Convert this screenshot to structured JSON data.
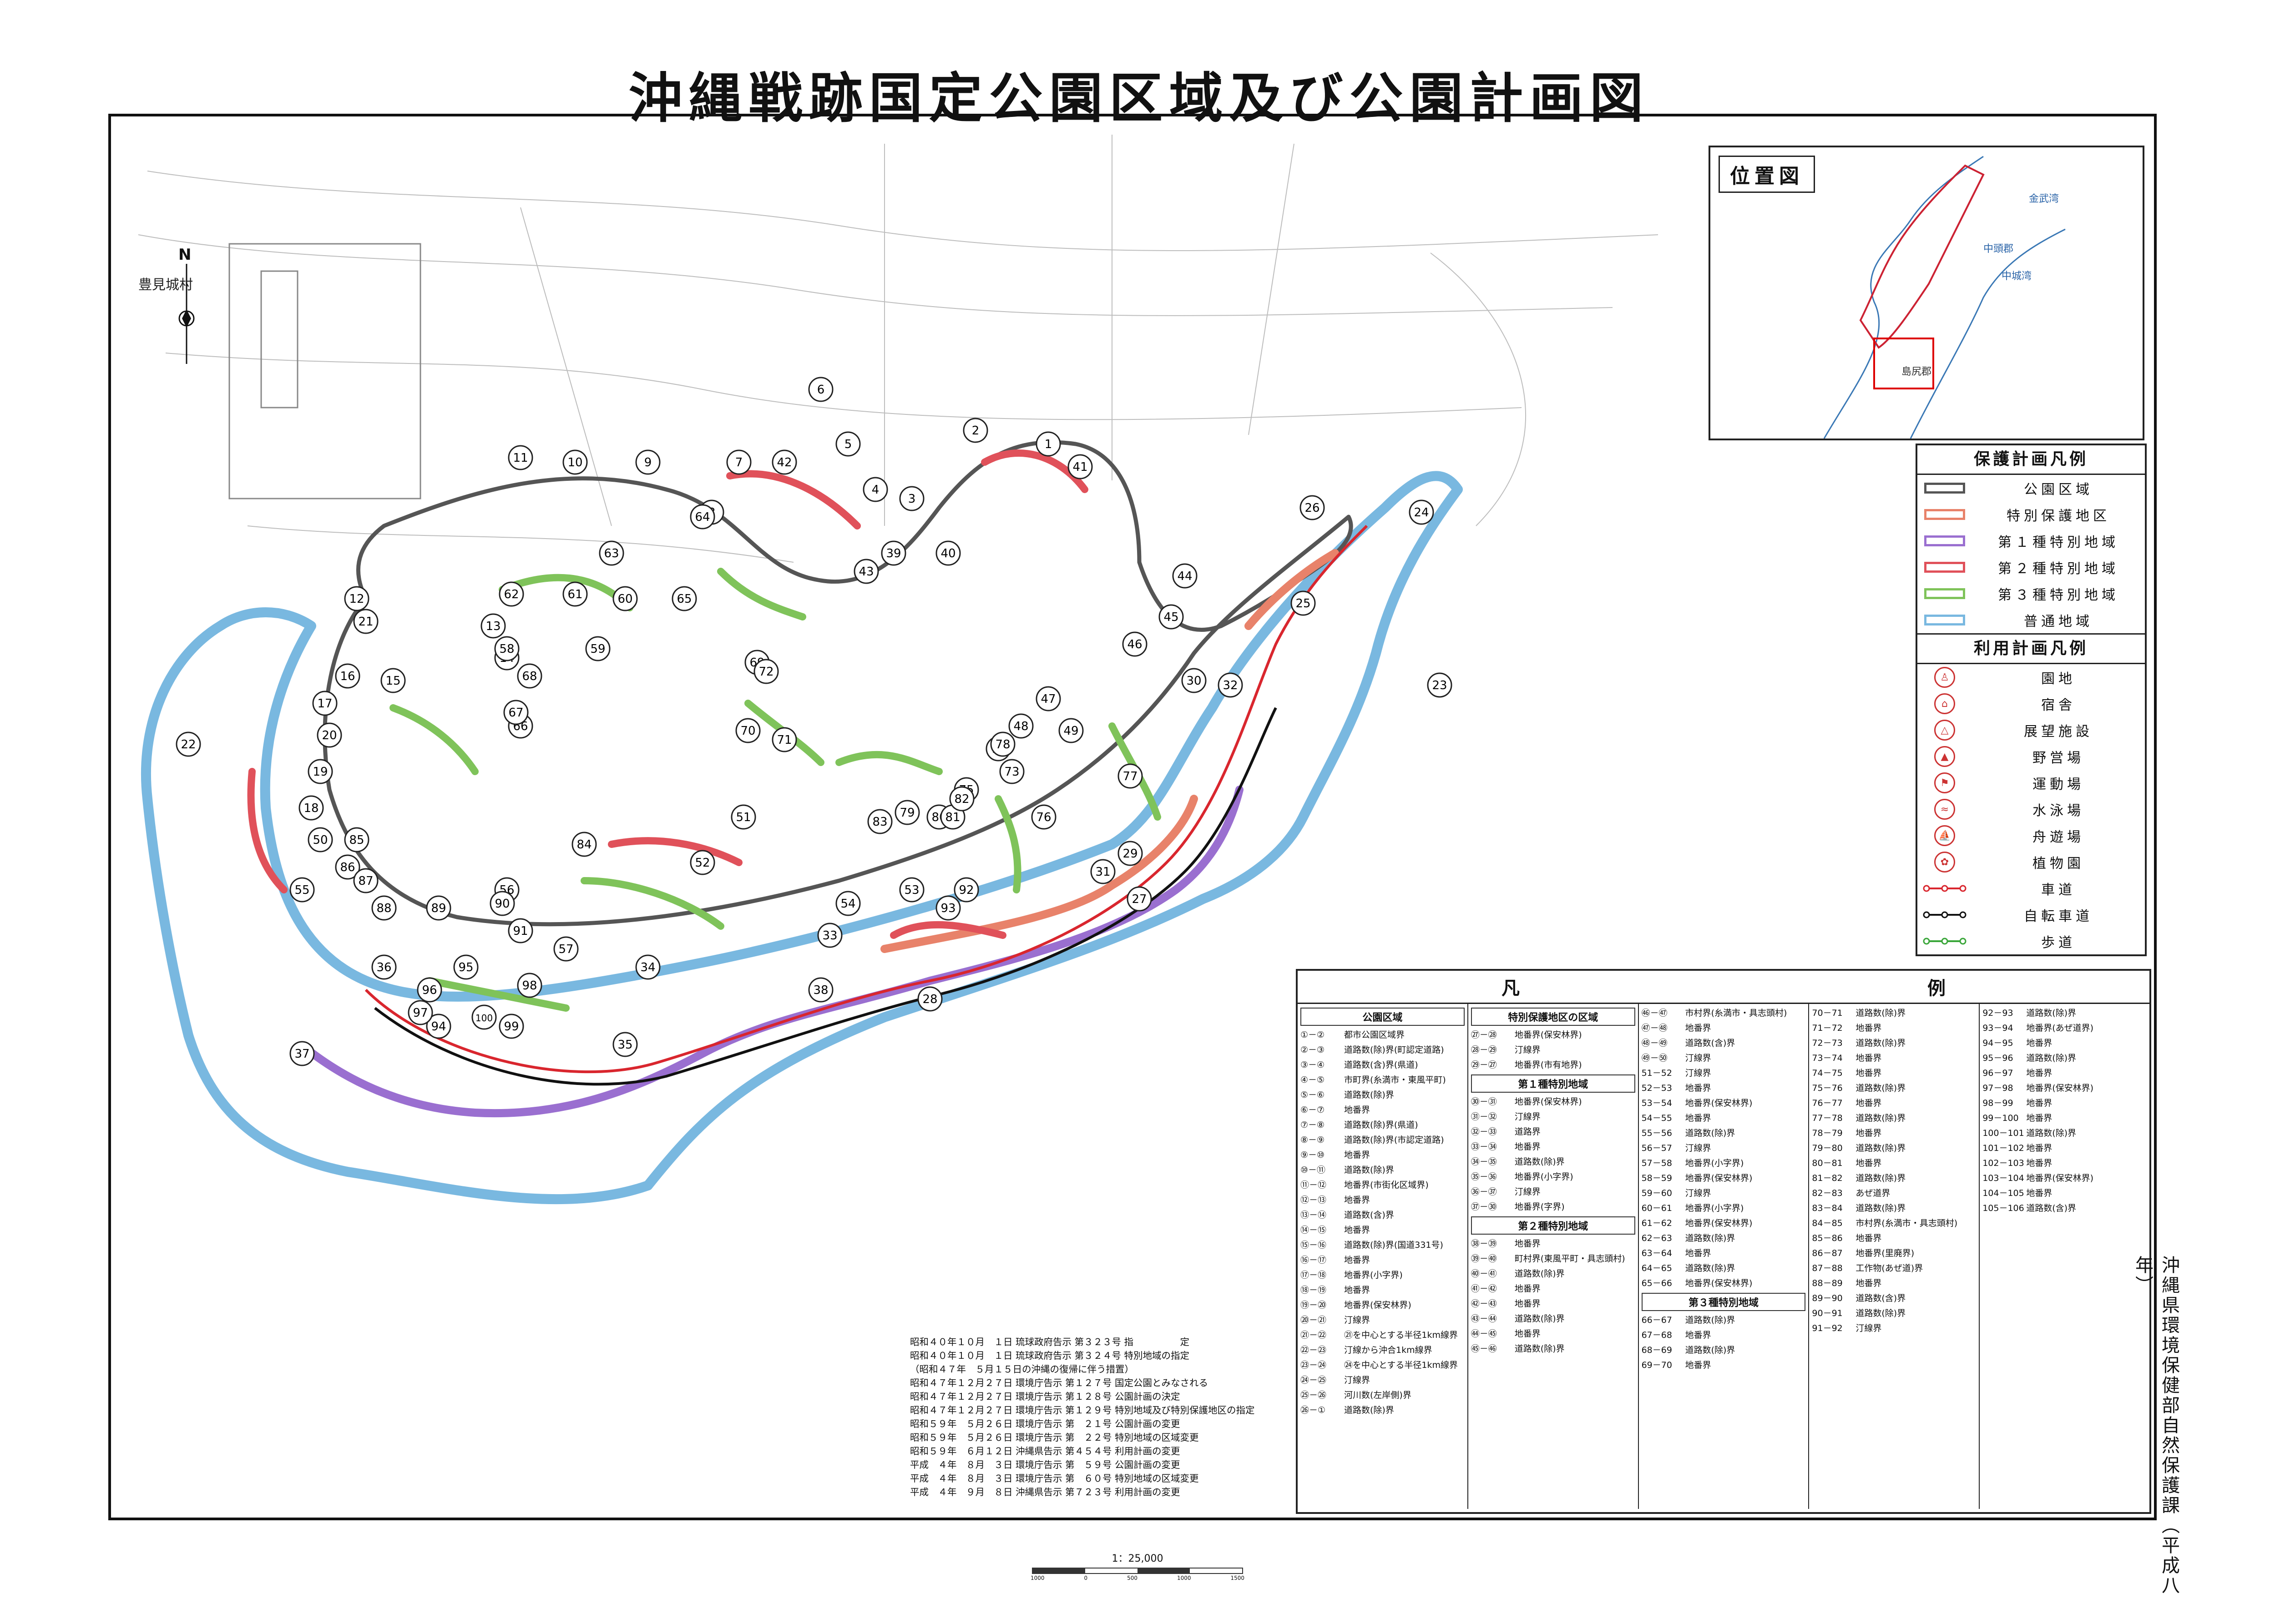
{
  "title": "沖縄戦跡国定公園区域及び公園計画図",
  "north_label": "N",
  "agency_vertical": "沖縄県環境保健部自然保護課（平成八年）",
  "colors": {
    "park_boundary": "#555555",
    "special_protection": "#e8826a",
    "class1_special": "#9a6fd0",
    "class2_special": "#e0515a",
    "class3_special": "#7fc35a",
    "ordinary": "#79b8e0",
    "road": "#d9262e",
    "cycle_road": "#111111",
    "footpath": "#3aa63a"
  },
  "inset": {
    "title": "位置図",
    "place_labels": [
      "中頭郡",
      "島尻郡",
      "中城湾",
      "金武湾"
    ]
  },
  "map_labels": {
    "village": "豊見城村",
    "markers": [
      "1",
      "2",
      "3",
      "4",
      "5",
      "6",
      "7",
      "8",
      "9",
      "10",
      "11",
      "12",
      "13",
      "14",
      "15",
      "16",
      "17",
      "18",
      "19",
      "20",
      "21",
      "22",
      "23",
      "24",
      "25",
      "26",
      "27",
      "28",
      "29",
      "30",
      "31",
      "32",
      "33",
      "34",
      "35",
      "36",
      "37",
      "38",
      "39",
      "40",
      "41",
      "42",
      "43",
      "44",
      "45",
      "46",
      "47",
      "48",
      "49",
      "50",
      "51",
      "52",
      "53",
      "54",
      "55",
      "56",
      "57",
      "58",
      "59",
      "60",
      "61",
      "62",
      "63",
      "64",
      "65",
      "66",
      "67",
      "68",
      "69",
      "70",
      "71",
      "72",
      "73",
      "74",
      "75",
      "76",
      "77",
      "78",
      "79",
      "80",
      "81",
      "82",
      "83",
      "84",
      "85",
      "86",
      "87",
      "88",
      "89",
      "90",
      "91",
      "92",
      "93",
      "94",
      "95",
      "96",
      "97",
      "98",
      "99",
      "100"
    ]
  },
  "protection_legend": {
    "title": "保護計画凡例",
    "items": [
      {
        "label": "公園区域",
        "color_key": "park_boundary"
      },
      {
        "label": "特別保護地区",
        "color_key": "special_protection"
      },
      {
        "label": "第１種特別地域",
        "color_key": "class1_special"
      },
      {
        "label": "第２種特別地域",
        "color_key": "class2_special"
      },
      {
        "label": "第３種特別地域",
        "color_key": "class3_special"
      },
      {
        "label": "普通地域",
        "color_key": "ordinary"
      }
    ]
  },
  "use_legend": {
    "title": "利用計画凡例",
    "facilities": [
      {
        "label": "園地",
        "glyph": "♙"
      },
      {
        "label": "宿舎",
        "glyph": "⌂"
      },
      {
        "label": "展望施設",
        "glyph": "△"
      },
      {
        "label": "野営場",
        "glyph": "▲"
      },
      {
        "label": "運動場",
        "glyph": "⚑"
      },
      {
        "label": "水泳場",
        "glyph": "≈"
      },
      {
        "label": "舟遊場",
        "glyph": "⛵"
      },
      {
        "label": "植物園",
        "glyph": "✿"
      }
    ],
    "routes": [
      {
        "label": "車道",
        "color_key": "road"
      },
      {
        "label": "自転車道",
        "color_key": "cycle_road"
      },
      {
        "label": "歩道",
        "color_key": "footpath"
      }
    ]
  },
  "boundary_table": {
    "title_left": "凡",
    "title_right": "例",
    "columns": [
      [
        {
          "section": "公園区域"
        },
        {
          "code": "①－②",
          "label": "都市公園区域界"
        },
        {
          "code": "②－③",
          "label": "道路数(除)界(町認定道路)"
        },
        {
          "code": "③－④",
          "label": "道路数(含)界(県道)"
        },
        {
          "code": "④－⑤",
          "label": "市町界(糸満市・東風平町)"
        },
        {
          "code": "⑤－⑥",
          "label": "道路数(除)界"
        },
        {
          "code": "⑥－⑦",
          "label": "地番界"
        },
        {
          "code": "⑦－⑧",
          "label": "道路数(除)界(県道)"
        },
        {
          "code": "⑧－⑨",
          "label": "道路数(除)界(市認定道路)"
        },
        {
          "code": "⑨－⑩",
          "label": "地番界"
        },
        {
          "code": "⑩－⑪",
          "label": "道路数(除)界"
        },
        {
          "code": "⑪－⑫",
          "label": "地番界(市街化区域界)"
        },
        {
          "code": "⑫－⑬",
          "label": "地番界"
        },
        {
          "code": "⑬－⑭",
          "label": "道路数(含)界"
        },
        {
          "code": "⑭－⑮",
          "label": "地番界"
        },
        {
          "code": "⑮－⑯",
          "label": "道路数(除)界(国道331号)"
        },
        {
          "code": "⑯－⑰",
          "label": "地番界"
        },
        {
          "code": "⑰－⑱",
          "label": "地番界(小字界)"
        },
        {
          "code": "⑱－⑲",
          "label": "地番界"
        },
        {
          "code": "⑲－⑳",
          "label": "地番界(保安林界)"
        },
        {
          "code": "⑳－㉑",
          "label": "汀線界"
        },
        {
          "code": "㉑－㉒",
          "label": "㉑を中心とする半径1km線界"
        },
        {
          "code": "㉒－㉓",
          "label": "汀線から沖合1km線界"
        },
        {
          "code": "㉓－㉔",
          "label": "㉔を中心とする半径1km線界"
        },
        {
          "code": "㉔－㉕",
          "label": "汀線界"
        },
        {
          "code": "㉕－㉖",
          "label": "河川数(左岸側)界"
        },
        {
          "code": "㉖－①",
          "label": "道路数(除)界"
        }
      ],
      [
        {
          "section": "特別保護地区の区域"
        },
        {
          "code": "㉗－㉘",
          "label": "地番界(保安林界)"
        },
        {
          "code": "㉘－㉙",
          "label": "汀線界"
        },
        {
          "code": "㉙－㉗",
          "label": "地番界(市有地界)"
        },
        {
          "section": "第１種特別地域"
        },
        {
          "code": "㉚－㉛",
          "label": "地番界(保安林界)"
        },
        {
          "code": "㉛－㉜",
          "label": "汀線界"
        },
        {
          "code": "㉜－㉝",
          "label": "道路界"
        },
        {
          "code": "㉝－㉞",
          "label": "地番界"
        },
        {
          "code": "㉞－㉟",
          "label": "道路数(除)界"
        },
        {
          "code": "㉟－㊱",
          "label": "地番界(小字界)"
        },
        {
          "code": "㊱－㊲",
          "label": "汀線界"
        },
        {
          "code": "㊲－㉚",
          "label": "地番界(字界)"
        },
        {
          "section": "第２種特別地域"
        },
        {
          "code": "㊳－㊴",
          "label": "地番界"
        },
        {
          "code": "㊴－㊵",
          "label": "町村界(東風平町・具志頭村)"
        },
        {
          "code": "㊵－㊶",
          "label": "道路数(除)界"
        },
        {
          "code": "㊶－㊷",
          "label": "地番界"
        },
        {
          "code": "㊷－㊸",
          "label": "地番界"
        },
        {
          "code": "㊸－㊹",
          "label": "道路数(除)界"
        },
        {
          "code": "㊹－㊺",
          "label": "地番界"
        },
        {
          "code": "㊺－㊻",
          "label": "道路数(除)界"
        }
      ],
      [
        {
          "code": "㊻－㊼",
          "label": "市村界(糸満市・具志頭村)"
        },
        {
          "code": "㊼－㊽",
          "label": "地番界"
        },
        {
          "code": "㊽－㊾",
          "label": "道路数(含)界"
        },
        {
          "code": "㊾－㊿",
          "label": "汀線界"
        },
        {
          "code": "51－52",
          "label": "汀線界"
        },
        {
          "code": "52－53",
          "label": "地番界"
        },
        {
          "code": "53－54",
          "label": "地番界(保安林界)"
        },
        {
          "code": "54－55",
          "label": "地番界"
        },
        {
          "code": "55－56",
          "label": "道路数(除)界"
        },
        {
          "code": "56－57",
          "label": "汀線界"
        },
        {
          "code": "57－58",
          "label": "地番界(小字界)"
        },
        {
          "code": "58－59",
          "label": "地番界(保安林界)"
        },
        {
          "code": "59－60",
          "label": "汀線界"
        },
        {
          "code": "60－61",
          "label": "地番界(小字界)"
        },
        {
          "code": "61－62",
          "label": "地番界(保安林界)"
        },
        {
          "code": "62－63",
          "label": "道路数(除)界"
        },
        {
          "code": "63－64",
          "label": "地番界"
        },
        {
          "code": "64－65",
          "label": "道路数(除)界"
        },
        {
          "code": "65－66",
          "label": "地番界(保安林界)"
        },
        {
          "section": "第３種特別地域"
        },
        {
          "code": "66－67",
          "label": "道路数(除)界"
        },
        {
          "code": "67－68",
          "label": "地番界"
        },
        {
          "code": "68－69",
          "label": "道路数(除)界"
        },
        {
          "code": "69－70",
          "label": "地番界"
        }
      ],
      [
        {
          "code": "70－71",
          "label": "道路数(除)界"
        },
        {
          "code": "71－72",
          "label": "地番界"
        },
        {
          "code": "72－73",
          "label": "道路数(除)界"
        },
        {
          "code": "73－74",
          "label": "地番界"
        },
        {
          "code": "74－75",
          "label": "地番界"
        },
        {
          "code": "75－76",
          "label": "道路数(除)界"
        },
        {
          "code": "76－77",
          "label": "地番界"
        },
        {
          "code": "77－78",
          "label": "道路数(除)界"
        },
        {
          "code": "78－79",
          "label": "地番界"
        },
        {
          "code": "79－80",
          "label": "道路数(除)界"
        },
        {
          "code": "80－81",
          "label": "地番界"
        },
        {
          "code": "81－82",
          "label": "道路数(除)界"
        },
        {
          "code": "82－83",
          "label": "あぜ道界"
        },
        {
          "code": "83－84",
          "label": "道路数(除)界"
        },
        {
          "code": "84－85",
          "label": "市村界(糸満市・具志頭村)"
        },
        {
          "code": "85－86",
          "label": "地番界"
        },
        {
          "code": "86－87",
          "label": "地番界(里廃界)"
        },
        {
          "code": "87－88",
          "label": "工作物(あぜ道)界"
        },
        {
          "code": "88－89",
          "label": "地番界"
        },
        {
          "code": "89－90",
          "label": "道路数(含)界"
        },
        {
          "code": "90－91",
          "label": "道路数(除)界"
        },
        {
          "code": "91－92",
          "label": "汀線界"
        }
      ],
      [
        {
          "code": "92－93",
          "label": "道路数(除)界"
        },
        {
          "code": "93－94",
          "label": "地番界(あぜ道界)"
        },
        {
          "code": "94－95",
          "label": "地番界"
        },
        {
          "code": "95－96",
          "label": "道路数(除)界"
        },
        {
          "code": "96－97",
          "label": "地番界"
        },
        {
          "code": "97－98",
          "label": "地番界(保安林界)"
        },
        {
          "code": "98－99",
          "label": "地番界"
        },
        {
          "code": "99－100",
          "label": "地番界"
        },
        {
          "code": "100－101",
          "label": "道路数(除)界"
        },
        {
          "code": "101－102",
          "label": "地番界"
        },
        {
          "code": "102－103",
          "label": "地番界"
        },
        {
          "code": "103－104",
          "label": "地番界(保安林界)"
        },
        {
          "code": "104－105",
          "label": "地番界"
        },
        {
          "code": "105－106",
          "label": "道路数(含)界"
        }
      ]
    ]
  },
  "notices": [
    "昭和４０年１０月　１日 琉球政府告示 第３２３号 指　　　　　定",
    "昭和４０年１０月　１日 琉球政府告示 第３２４号 特別地域の指定",
    "（昭和４７年　５月１５日の沖縄の復帰に伴う措置）",
    "昭和４７年１２月２７日 環境庁告示 第１２７号 国定公園とみなされる",
    "昭和４７年１２月２７日 環境庁告示 第１２８号 公園計画の決定",
    "昭和４７年１２月２７日 環境庁告示 第１２９号 特別地域及び特別保護地区の指定",
    "昭和５９年　５月２６日 環境庁告示 第　２１号 公園計画の変更",
    "昭和５９年　５月２６日 環境庁告示 第　２２号 特別地域の区域変更",
    "昭和５９年　６月１２日 沖縄県告示 第４５４号 利用計画の変更",
    "平成　４年　８月　３日 環境庁告示 第　５９号 公園計画の変更",
    "平成　４年　８月　３日 環境庁告示 第　６０号 特別地域の区域変更",
    "平成　４年　９月　８日 沖縄県告示 第７２３号 利用計画の変更"
  ],
  "scale": {
    "text": "1：25,000",
    "ticks": [
      "1000",
      "0",
      "500",
      "1000",
      "1500"
    ]
  }
}
